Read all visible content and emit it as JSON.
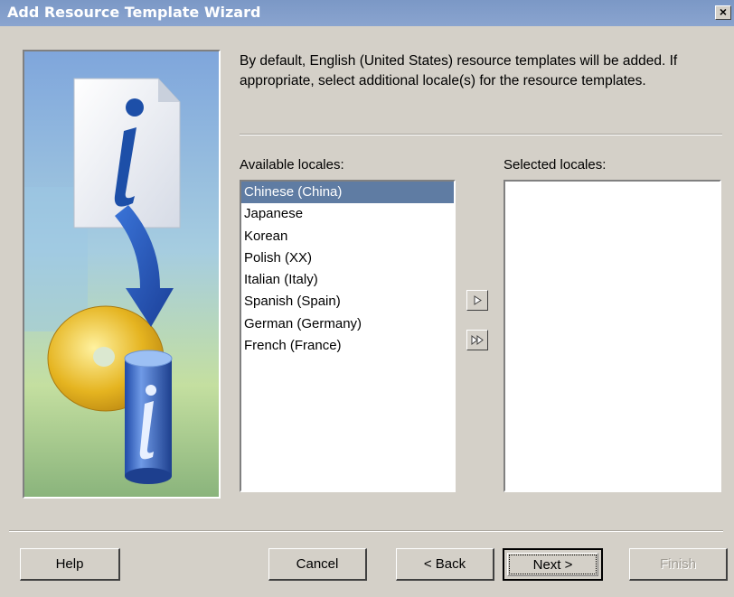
{
  "window": {
    "title": "Add Resource Template Wizard",
    "close_label": "×"
  },
  "intro_text": "By default, English (United States) resource templates will be added. If appropriate, select additional locale(s) for the resource templates.",
  "available": {
    "label": "Available locales:",
    "items": [
      "Chinese (China)",
      "Japanese",
      "Korean",
      "Polish (XX)",
      "Italian (Italy)",
      "Spanish (Spain)",
      "German (Germany)",
      "French (France)"
    ],
    "selected_index": 0
  },
  "selected": {
    "label": "Selected locales:",
    "items": []
  },
  "buttons": {
    "help": "Help",
    "cancel": "Cancel",
    "back": "< Back",
    "next": "Next >",
    "finish": "Finish"
  },
  "icons": {
    "move_one": "arrow-right-icon",
    "move_all": "double-arrow-right-icon",
    "illustration": "info-document-cd-database-illustration"
  },
  "colors": {
    "titlebar": "#7b98c6",
    "selection": "#5f7ca3",
    "face": "#d4d0c8"
  }
}
